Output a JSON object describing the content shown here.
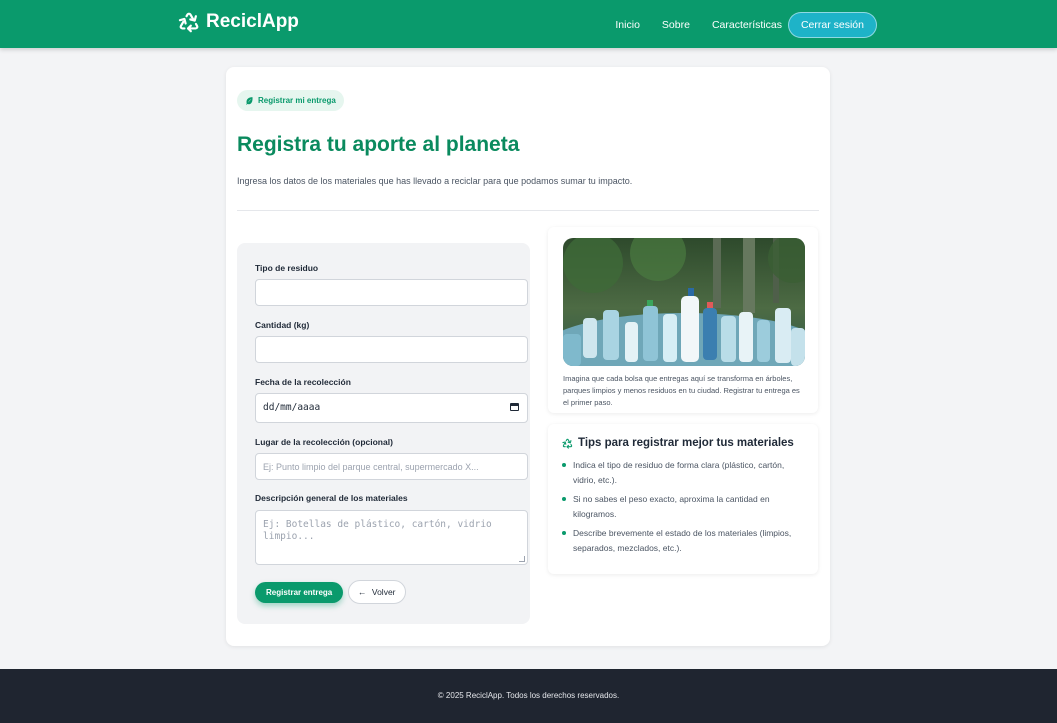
{
  "nav": {
    "brand": "ReciclApp",
    "links": [
      "Inicio",
      "Sobre",
      "Características"
    ],
    "logout": "Cerrar sesión"
  },
  "page": {
    "badge": "Registrar mi entrega",
    "title": "Registra tu aporte al planeta",
    "subtitle": "Ingresa los datos de los materiales que has llevado a reciclar para que podamos sumar tu impacto."
  },
  "form": {
    "type_label": "Tipo de residuo",
    "type_value": "",
    "quantity_label": "Cantidad (kg)",
    "quantity_value": "",
    "date_label": "Fecha de la recolección",
    "date_value": "dd/mm/aaaa",
    "place_label": "Lugar de la recolección (opcional)",
    "place_placeholder": "Ej: Punto limpio del parque central, supermercado X...",
    "desc_label": "Descripción general de los materiales",
    "desc_placeholder": "Ej: Botellas de plástico, cartón, vidrio limpio...",
    "submit": "Registrar entrega",
    "back": "Volver"
  },
  "image_card": {
    "caption": "Imagina que cada bolsa que entregas aquí se transforma en árboles, parques limpios y menos residuos en tu ciudad. Registrar tu entrega es el primer paso."
  },
  "tips": {
    "title": "Tips para registrar mejor tus materiales",
    "items": [
      "Indica el tipo de residuo de forma clara (plástico, cartón, vidrio, etc.).",
      "Si no sabes el peso exacto, aproxima la cantidad en kilogramos.",
      "Describe brevemente el estado de los materiales (limpios, separados, mezclados, etc.)."
    ]
  },
  "footer": {
    "text": "© 2025 ReciclApp. Todos los derechos reservados."
  },
  "colors": {
    "primary": "#0a9a6c",
    "accent": "#1eb3c8",
    "footer_bg": "#1f2530"
  },
  "icons": [
    "recycle-icon",
    "leaf-icon",
    "calendar-icon",
    "arrow-left-icon"
  ]
}
